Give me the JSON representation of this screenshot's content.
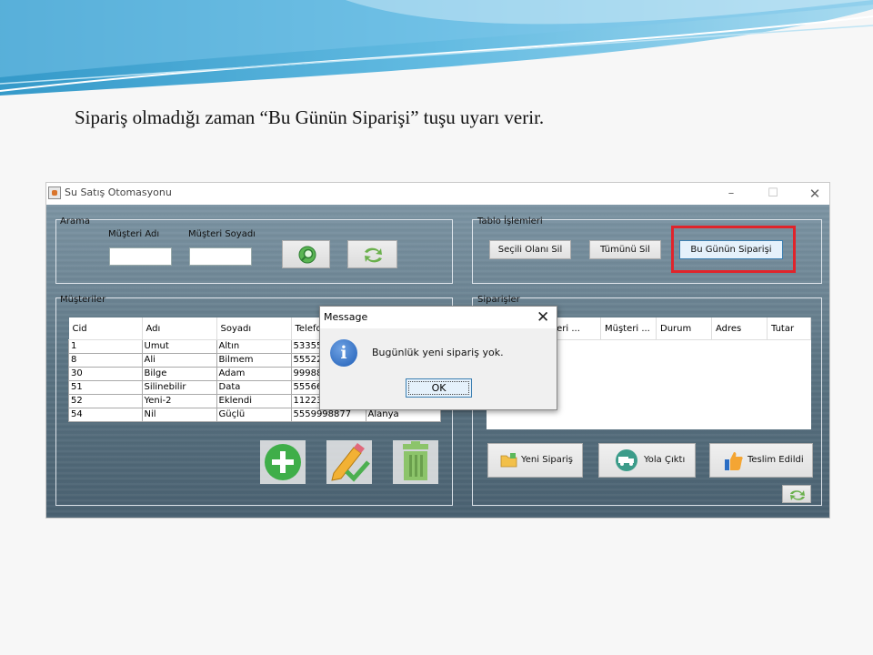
{
  "caption": "Sipariş olmadığı zaman “Bu Günün Siparişi” tuşu uyarı verir.",
  "window": {
    "title": "Su Satış Otomasyonu",
    "minimize": "–",
    "maximize": "☐",
    "close": "✕"
  },
  "arama": {
    "title": "Arama",
    "ad_label": "Müşteri Adı",
    "soyad_label": "Müşteri Soyadı",
    "ad_value": "",
    "soyad_value": ""
  },
  "tablo": {
    "title": "Tablo İşlemleri",
    "secili_sil": "Seçili Olanı Sil",
    "tumunu_sil": "Tümünü Sil",
    "bu_gunun": "Bu Günün Siparişi"
  },
  "musteriler": {
    "title": "Müşteriler",
    "columns": [
      "Cid",
      "Adı",
      "Soyadı",
      "Telefo"
    ],
    "rows": [
      [
        "1",
        "Umut",
        "Altın",
        "53355"
      ],
      [
        "8",
        "Ali",
        "Bilmem",
        "55522"
      ],
      [
        "30",
        "Bilge",
        "Adam",
        "99988"
      ],
      [
        "51",
        "Silinebilir",
        "Data",
        "55566"
      ],
      [
        "52",
        "Yeni-2",
        "Eklendi",
        "11223"
      ],
      [
        "54",
        "Nil",
        "Güçlü",
        "5559998877",
        "Alanya"
      ]
    ]
  },
  "siparisler": {
    "title": "Siparişler",
    "columns": [
      "şteri ...",
      "Müşteri ...",
      "Durum",
      "Adres",
      "Tutar"
    ],
    "yeni": "Yeni Sipariş",
    "yola": "Yola Çıktı",
    "teslim": "Teslim Edildi"
  },
  "dialog": {
    "title": "Message",
    "close": "✕",
    "icon": "i",
    "message": "Bugünlük yeni sipariş yok.",
    "ok": "OK"
  },
  "colors": {
    "highlight": "#e0242b",
    "add_green": "#3fae49"
  }
}
